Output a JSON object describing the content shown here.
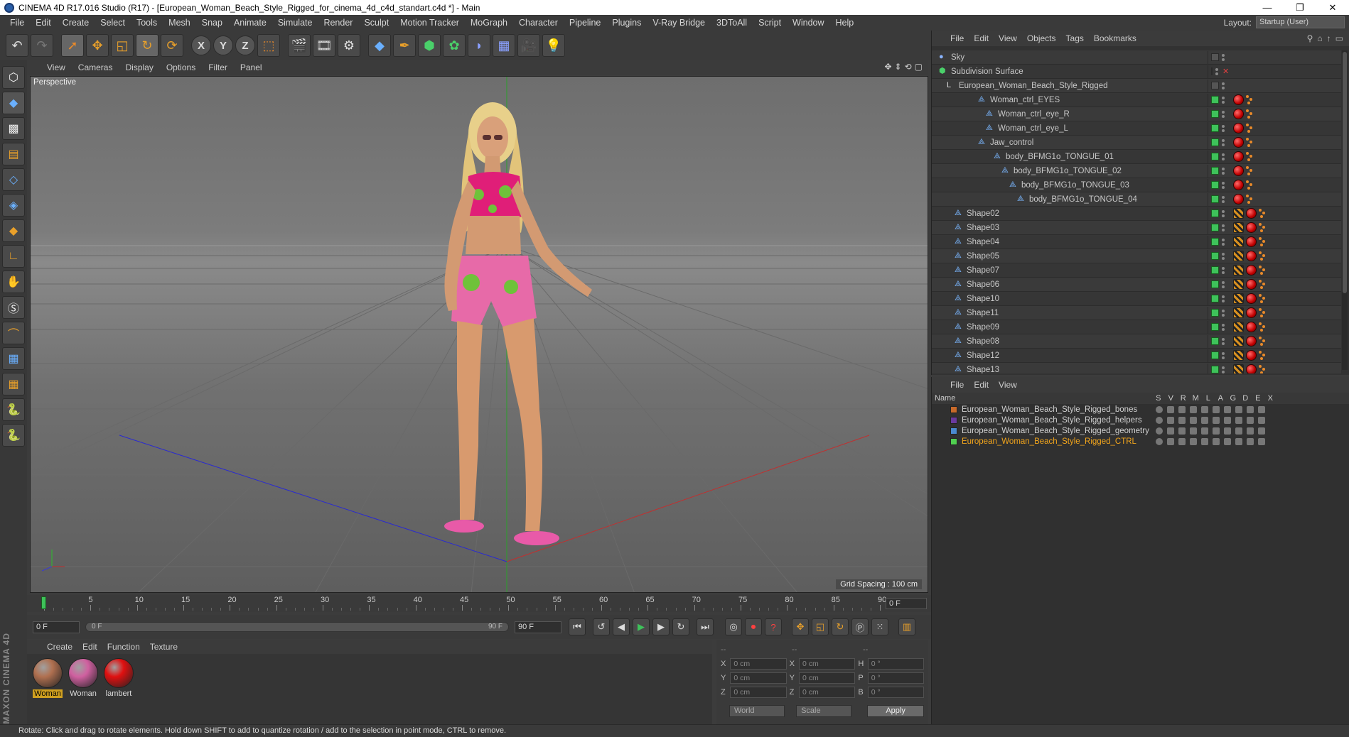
{
  "window": {
    "title": "CINEMA 4D R17.016 Studio (R17) - [European_Woman_Beach_Style_Rigged_for_cinema_4d_c4d_standart.c4d *] - Main",
    "minimize": "—",
    "restore": "❐",
    "close": "✕"
  },
  "menubar": {
    "items": [
      "File",
      "Edit",
      "Create",
      "Select",
      "Tools",
      "Mesh",
      "Snap",
      "Animate",
      "Simulate",
      "Render",
      "Sculpt",
      "Motion Tracker",
      "MoGraph",
      "Character",
      "Pipeline",
      "Plugins",
      "V-Ray Bridge",
      "3DToAll",
      "Script",
      "Window",
      "Help"
    ],
    "layout_label": "Layout:",
    "layout_value": "Startup (User)"
  },
  "viewport": {
    "menu": [
      "View",
      "Cameras",
      "Display",
      "Options",
      "Filter",
      "Panel"
    ],
    "label": "Perspective",
    "grid_spacing": "Grid Spacing : 100 cm"
  },
  "timeline": {
    "ticks": [
      "0",
      "5",
      "10",
      "15",
      "20",
      "25",
      "30",
      "35",
      "40",
      "45",
      "50",
      "55",
      "60",
      "65",
      "70",
      "75",
      "80",
      "85",
      "90"
    ],
    "current_frame": "0 F"
  },
  "transport": {
    "start": "0 F",
    "range_start": "0 F",
    "range_end": "90 F",
    "end": "90 F"
  },
  "material_panel": {
    "menu": [
      "Create",
      "Edit",
      "Function",
      "Texture"
    ],
    "materials": [
      {
        "name": "Woman",
        "color": "#b07050",
        "selected": true
      },
      {
        "name": "Woman",
        "color": "#d060a0",
        "selected": false
      },
      {
        "name": "lambert",
        "color": "#e01010",
        "selected": false
      }
    ]
  },
  "coords": {
    "headers": [
      "--",
      "--",
      "--"
    ],
    "rows": [
      {
        "a": "X",
        "v1": "0 cm",
        "b": "X",
        "v2": "0 cm",
        "c": "H",
        "v3": "0 °"
      },
      {
        "a": "Y",
        "v1": "0 cm",
        "b": "Y",
        "v2": "0 cm",
        "c": "P",
        "v3": "0 °"
      },
      {
        "a": "Z",
        "v1": "0 cm",
        "b": "Z",
        "v2": "0 cm",
        "c": "B",
        "v3": "0 °"
      }
    ],
    "world": "World",
    "scale": "Scale",
    "apply": "Apply"
  },
  "object_manager": {
    "menu": [
      "File",
      "Edit",
      "View",
      "Objects",
      "Tags",
      "Bookmarks"
    ],
    "objects": [
      {
        "name": "Sky",
        "indent": 0,
        "kind": "sky"
      },
      {
        "name": "Subdivision Surface",
        "indent": 0,
        "kind": "subd"
      },
      {
        "name": "European_Woman_Beach_Style_Rigged",
        "indent": 1,
        "kind": "null"
      },
      {
        "name": "Woman_ctrl_EYES",
        "indent": 5,
        "kind": "joint"
      },
      {
        "name": "Woman_ctrl_eye_R",
        "indent": 6,
        "kind": "joint"
      },
      {
        "name": "Woman_ctrl_eye_L",
        "indent": 6,
        "kind": "joint"
      },
      {
        "name": "Jaw_control",
        "indent": 5,
        "kind": "joint"
      },
      {
        "name": "body_BFMG1o_TONGUE_01",
        "indent": 7,
        "kind": "joint"
      },
      {
        "name": "body_BFMG1o_TONGUE_02",
        "indent": 8,
        "kind": "joint"
      },
      {
        "name": "body_BFMG1o_TONGUE_03",
        "indent": 9,
        "kind": "joint"
      },
      {
        "name": "body_BFMG1o_TONGUE_04",
        "indent": 10,
        "kind": "joint"
      },
      {
        "name": "Shape02",
        "indent": 2,
        "kind": "shape"
      },
      {
        "name": "Shape03",
        "indent": 2,
        "kind": "shape"
      },
      {
        "name": "Shape04",
        "indent": 2,
        "kind": "shape"
      },
      {
        "name": "Shape05",
        "indent": 2,
        "kind": "shape"
      },
      {
        "name": "Shape07",
        "indent": 2,
        "kind": "shape"
      },
      {
        "name": "Shape06",
        "indent": 2,
        "kind": "shape"
      },
      {
        "name": "Shape10",
        "indent": 2,
        "kind": "shape"
      },
      {
        "name": "Shape11",
        "indent": 2,
        "kind": "shape"
      },
      {
        "name": "Shape09",
        "indent": 2,
        "kind": "shape"
      },
      {
        "name": "Shape08",
        "indent": 2,
        "kind": "shape"
      },
      {
        "name": "Shape12",
        "indent": 2,
        "kind": "shape"
      },
      {
        "name": "Shape13",
        "indent": 2,
        "kind": "shape"
      }
    ]
  },
  "layer_manager": {
    "menu": [
      "File",
      "Edit",
      "View"
    ],
    "name_header": "Name",
    "columns": [
      "S",
      "V",
      "R",
      "M",
      "L",
      "A",
      "G",
      "D",
      "E",
      "X"
    ],
    "layers": [
      {
        "name": "European_Woman_Beach_Style_Rigged_bones",
        "color": "#c86a2a",
        "active": false
      },
      {
        "name": "European_Woman_Beach_Style_Rigged_helpers",
        "color": "#6a3aa0",
        "active": false
      },
      {
        "name": "European_Woman_Beach_Style_Rigged_geometry",
        "color": "#4a8ad0",
        "active": false
      },
      {
        "name": "European_Woman_Beach_Style_Rigged_CTRL",
        "color": "#50d050",
        "active": true
      }
    ]
  },
  "status": "Rotate: Click and drag to rotate elements. Hold down SHIFT to add to quantize rotation / add to the selection in point mode, CTRL to remove.",
  "brand": "MAXON CINEMA 4D"
}
